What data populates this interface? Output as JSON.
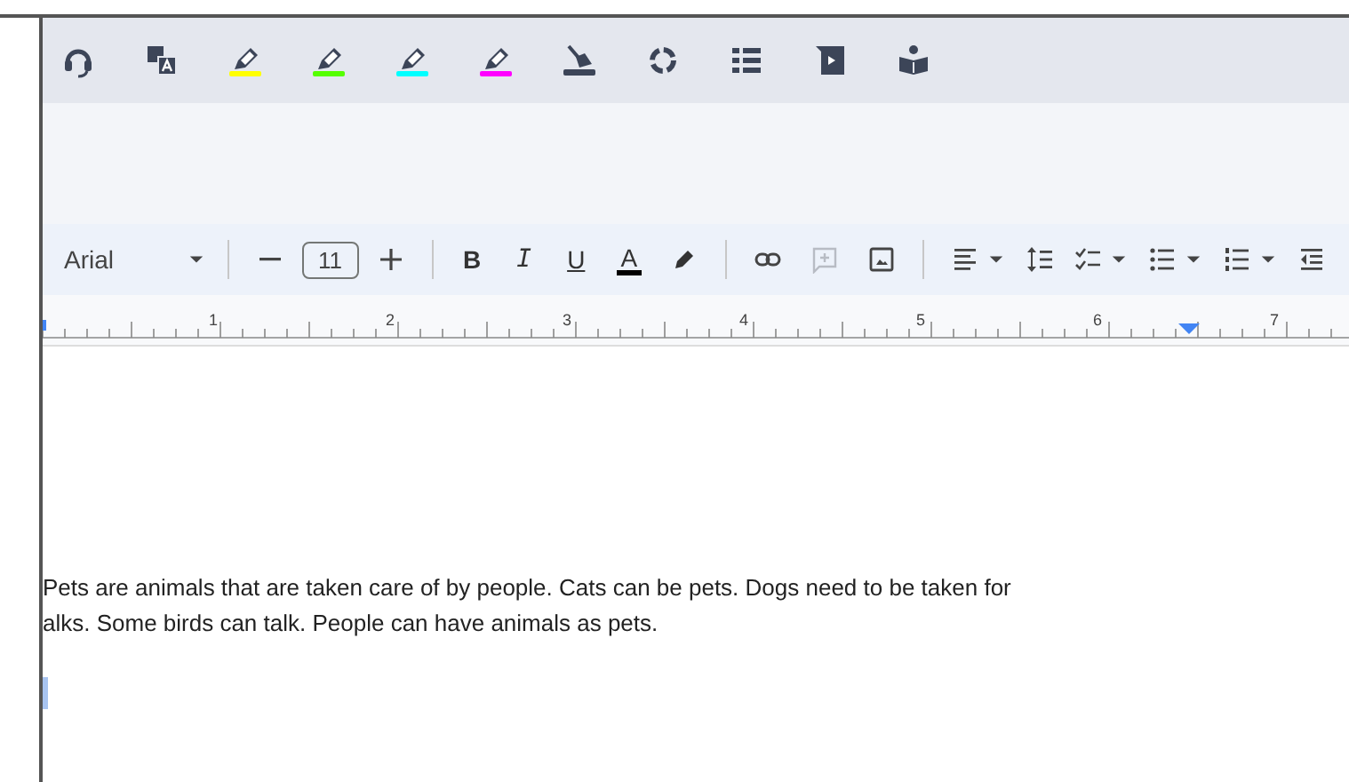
{
  "extension_toolbar": {
    "items": [
      {
        "kind": "headset"
      },
      {
        "kind": "translate"
      },
      {
        "kind": "highlighter",
        "color": "#ffff00"
      },
      {
        "kind": "highlighter",
        "color": "#55ff00"
      },
      {
        "kind": "highlighter",
        "color": "#00ffff"
      },
      {
        "kind": "highlighter",
        "color": "#ff00ff"
      },
      {
        "kind": "eraser"
      },
      {
        "kind": "cycle"
      },
      {
        "kind": "list"
      },
      {
        "kind": "video"
      },
      {
        "kind": "reader"
      }
    ]
  },
  "format_toolbar": {
    "font": "Arial",
    "font_size": "11",
    "items": [
      {
        "kind": "divider"
      },
      {
        "kind": "minus"
      },
      {
        "kind": "size"
      },
      {
        "kind": "plus"
      },
      {
        "kind": "divider"
      },
      {
        "kind": "bold",
        "label": "B"
      },
      {
        "kind": "italic",
        "label": "I"
      },
      {
        "kind": "underline",
        "label": "U"
      },
      {
        "kind": "text-color",
        "label": "A",
        "color": "#000000"
      },
      {
        "kind": "pen"
      },
      {
        "kind": "divider"
      },
      {
        "kind": "link"
      },
      {
        "kind": "comment",
        "disabled": true
      },
      {
        "kind": "image"
      },
      {
        "kind": "divider"
      },
      {
        "kind": "align",
        "dropdown": true
      },
      {
        "kind": "spacing",
        "dropdown": false
      },
      {
        "kind": "checklist",
        "dropdown": true
      },
      {
        "kind": "bullets",
        "dropdown": true
      },
      {
        "kind": "numbered",
        "dropdown": true
      },
      {
        "kind": "indent",
        "dropdown": false
      }
    ]
  },
  "ruler": {
    "labels": [
      "1",
      "2",
      "3",
      "4",
      "5",
      "6",
      "7"
    ]
  },
  "document": {
    "paragraph": [
      "Pets are animals that are taken care of by people. Cats can be pets. Dogs need to be taken for",
      "alks. Some birds can talk. People can have animals as pets."
    ]
  }
}
